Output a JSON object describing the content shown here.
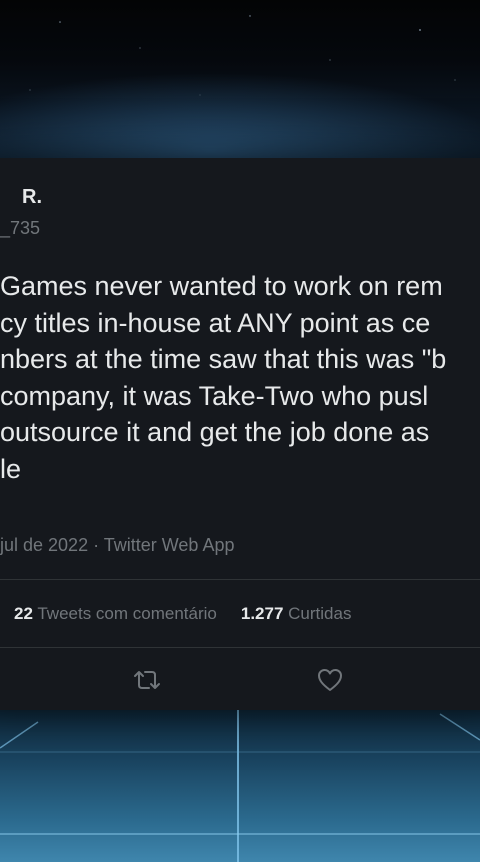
{
  "tweet": {
    "display_name": "R.",
    "handle": "_735",
    "text_lines": [
      "Games never wanted to work on rem",
      "cy titles in-house at ANY point as ce",
      "nbers at the time saw that this was \"b",
      "company, it was Take-Two who pusl",
      "outsource it and get the job done as",
      "le"
    ],
    "meta": "jul de 2022 · Twitter Web App",
    "stats": {
      "quote_count": "22",
      "quote_label": "Tweets com comentário",
      "like_count": "1.277",
      "like_label": "Curtidas"
    },
    "actions": {
      "retweet_icon": "retweet-icon",
      "like_icon": "heart-icon"
    }
  },
  "colors": {
    "card_bg": "#15181d",
    "text_primary": "#e7e9ea",
    "text_secondary": "#71767b",
    "divider": "#2f3336",
    "backdrop_glow": "#3f86ad"
  }
}
